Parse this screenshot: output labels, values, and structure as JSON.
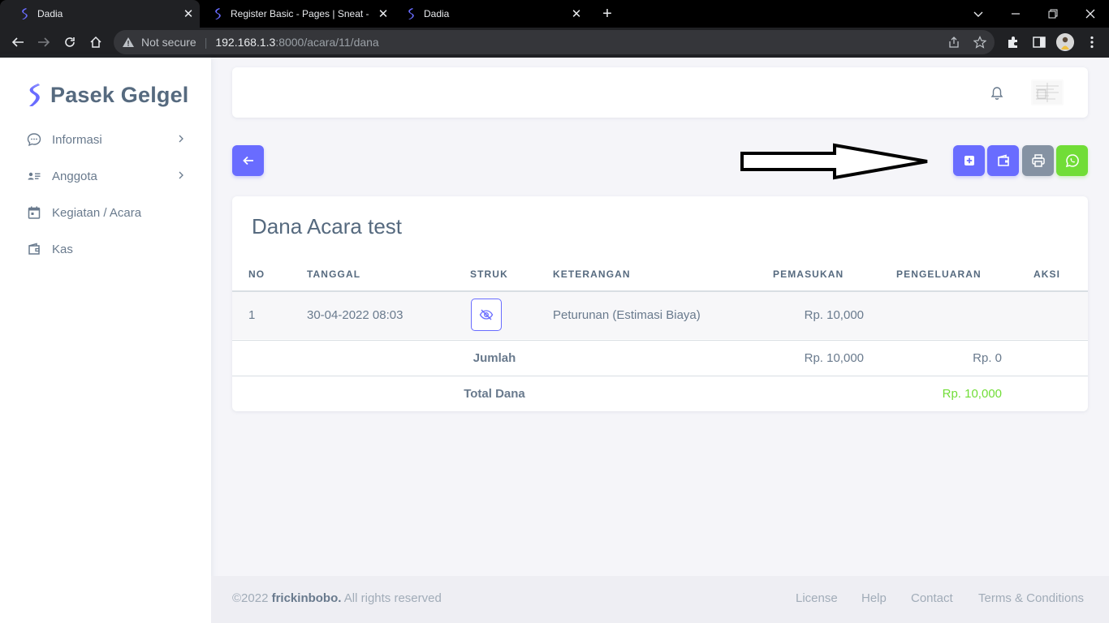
{
  "browser": {
    "tabs": [
      {
        "title": "Dadia",
        "active": true
      },
      {
        "title": "Register Basic - Pages | Sneat - B",
        "active": false
      },
      {
        "title": "Dadia",
        "active": false
      }
    ],
    "address": {
      "security_label": "Not secure",
      "host": "192.168.1.3",
      "path": ":8000/acara/11/dana"
    }
  },
  "sidebar": {
    "brand": "Pasek Gelgel",
    "items": [
      {
        "label": "Informasi",
        "icon": "chat-bubble-icon",
        "has_submenu": true
      },
      {
        "label": "Anggota",
        "icon": "id-card-icon",
        "has_submenu": true
      },
      {
        "label": "Kegiatan / Acara",
        "icon": "calendar-icon",
        "has_submenu": false
      },
      {
        "label": "Kas",
        "icon": "wallet-icon",
        "has_submenu": false
      }
    ]
  },
  "actions": {
    "back": "arrow-left-icon",
    "add": "plus-square-icon",
    "wallet": "wallet-icon",
    "print": "printer-icon",
    "whatsapp": "whatsapp-icon"
  },
  "colors": {
    "primary": "#696cff",
    "secondary": "#8592a3",
    "success": "#71dd37",
    "heading": "#566a7f",
    "body": "#697a8d"
  },
  "card": {
    "title": "Dana Acara test",
    "headers": [
      "NO",
      "TANGGAL",
      "STRUK",
      "KETERANGAN",
      "PEMASUKAN",
      "PENGELUARAN",
      "AKSI"
    ],
    "rows": [
      {
        "no": "1",
        "tanggal": "30-04-2022 08:03",
        "struk": "eye-off-icon",
        "keterangan": "Peturunan (Estimasi Biaya)",
        "pemasukan": "Rp. 10,000",
        "pengeluaran": "",
        "aksi": ""
      }
    ],
    "jumlah": {
      "label": "Jumlah",
      "pemasukan": "Rp. 10,000",
      "pengeluaran": "Rp. 0"
    },
    "total": {
      "label": "Total Dana",
      "value": "Rp. 10,000"
    }
  },
  "footer": {
    "copyright": "©2022",
    "author": "frickinbobo.",
    "rights": "All rights reserved",
    "links": [
      "License",
      "Help",
      "Contact",
      "Terms & Conditions"
    ]
  }
}
